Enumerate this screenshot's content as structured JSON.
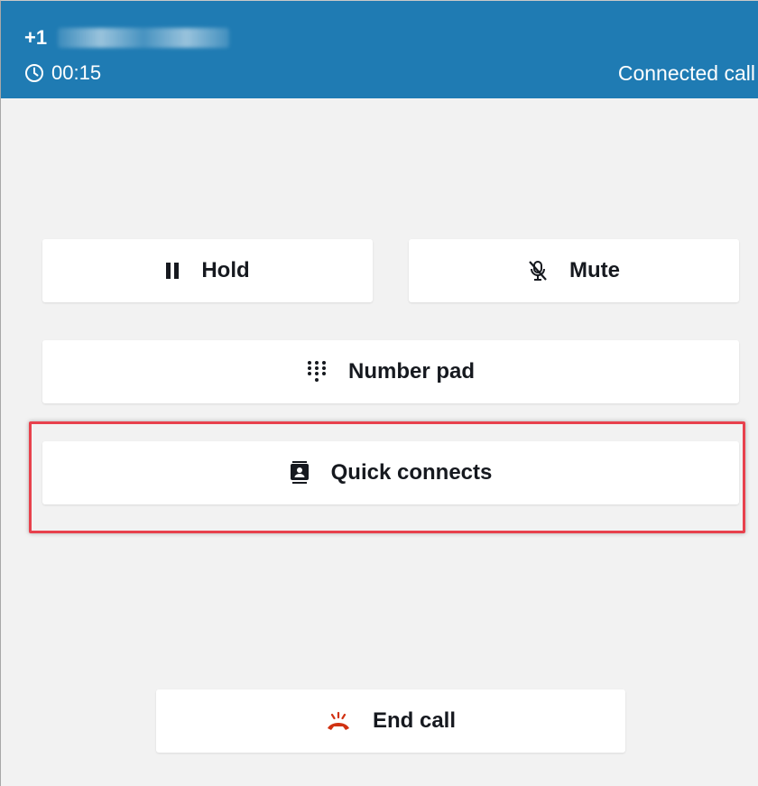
{
  "header": {
    "phone_prefix": "+1",
    "timer": "00:15",
    "status": "Connected call",
    "timer_icon": "clock-icon",
    "background_color": "#1f7bb3"
  },
  "controls": {
    "hold": {
      "label": "Hold",
      "icon": "pause-icon"
    },
    "mute": {
      "label": "Mute",
      "icon": "microphone-muted-icon"
    },
    "number_pad": {
      "label": "Number pad",
      "icon": "dialpad-icon"
    },
    "quick_connects": {
      "label": "Quick connects",
      "icon": "contact-card-icon",
      "highlighted": true,
      "highlight_color": "#e8414d"
    },
    "end_call": {
      "label": "End call",
      "icon": "hangup-phone-icon",
      "icon_color": "#d13212"
    }
  }
}
